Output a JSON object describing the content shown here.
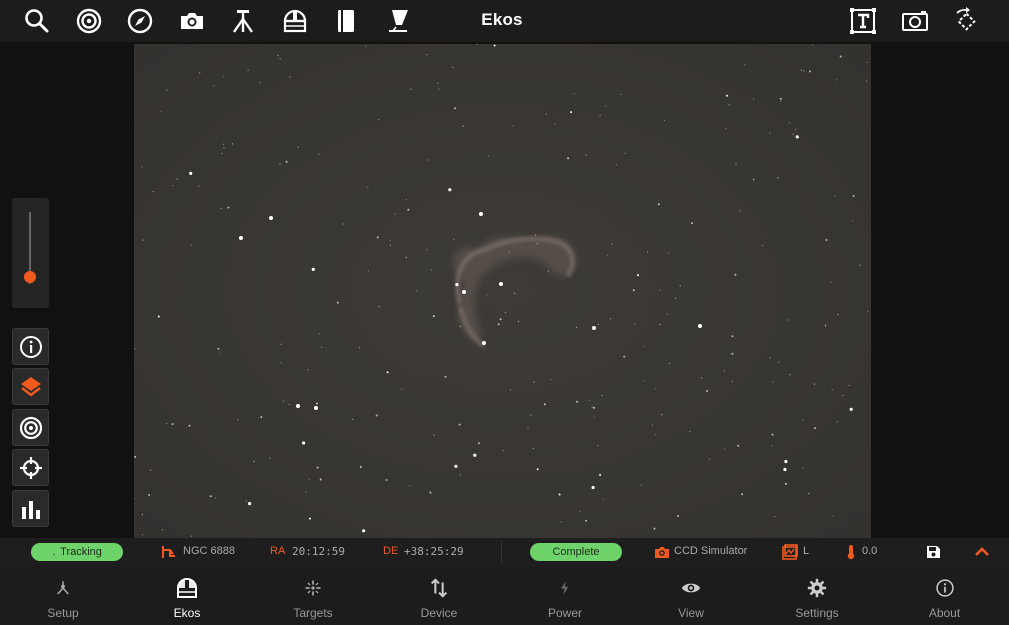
{
  "app": {
    "title": "Ekos"
  },
  "toolbar": {
    "left_icons": [
      "search-icon",
      "target-icon",
      "compass-icon",
      "camera-icon",
      "tripod-icon",
      "observatory-icon",
      "book-icon",
      "telescope-icon"
    ],
    "right_icons": [
      "text-annotation-icon",
      "capture-frame-icon",
      "rotate-icon"
    ]
  },
  "status": {
    "tracking": "Tracking",
    "target": "NGC 6888",
    "ra_label": "RA",
    "ra_value": "20:12:59",
    "de_label": "DE",
    "de_value": "+38:25:29",
    "capture_state": "Complete",
    "camera": "CCD Simulator",
    "filter": "L",
    "temperature": "0.0"
  },
  "colors": {
    "accent": "#f05a1e",
    "status_green": "#6fd36b",
    "sky_background": "#3c3935"
  },
  "zoom": {
    "level": 0.1
  },
  "side_buttons": [
    "info-icon",
    "layers-icon",
    "target-icon",
    "crosshair-icon",
    "histogram-icon"
  ],
  "nav": {
    "items": [
      {
        "label": "Setup",
        "icon": "setup-icon"
      },
      {
        "label": "Ekos",
        "icon": "ekos-icon"
      },
      {
        "label": "Targets",
        "icon": "targets-icon"
      },
      {
        "label": "Device",
        "icon": "device-icon"
      },
      {
        "label": "Power",
        "icon": "power-icon"
      },
      {
        "label": "View",
        "icon": "eye-icon"
      },
      {
        "label": "Settings",
        "icon": "gear-icon"
      },
      {
        "label": "About",
        "icon": "about-icon"
      }
    ],
    "active": "Ekos"
  }
}
